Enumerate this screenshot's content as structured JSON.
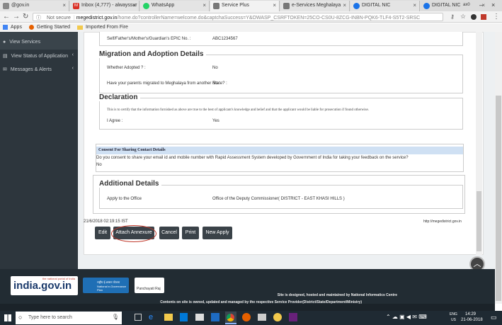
{
  "browser": {
    "tabs": [
      {
        "label": "@gov.in",
        "color": "#888888"
      },
      {
        "label": "Inbox (4,777) - alwayssur",
        "color": "#d93025"
      },
      {
        "label": "WhatsApp",
        "color": "#25d366"
      },
      {
        "label": "Service Plus",
        "color": "#777777"
      },
      {
        "label": "e-Services Meghalaya",
        "color": "#777777"
      },
      {
        "label": "DIGITAL NIC",
        "color": "#1a73e8"
      },
      {
        "label": "DIGITAL NIC",
        "color": "#1a73e8"
      }
    ],
    "active_tab": 3,
    "window_user": "ax0",
    "url_security": "Not secure",
    "url_host": "megedistrict.gov.in",
    "url_path": "/home.do?controllerName=welcome.do&captchaSuccess=Y&OWASP_CSRFTOKEN=25CO-CS0U-8ZCG-INBN-PQK6-TLF4-S5T2-SRSC",
    "bookmarks": [
      "Apps",
      "Getting Started",
      "Imported From Fire"
    ]
  },
  "sidebar": {
    "items": [
      {
        "label": "View Services",
        "icon": "circle-icon",
        "has_arrow": false
      },
      {
        "label": "View Status of Application",
        "icon": "list-icon",
        "has_arrow": true
      },
      {
        "label": "Messages & Alerts",
        "icon": "envelope-icon",
        "has_arrow": true
      }
    ]
  },
  "form": {
    "epic_label": "Self/Father's/Mother's/Guardian's EPIC No. :",
    "epic_value": "ABC1234567",
    "migration_heading": "Migration and Adoption Details",
    "adopted_label": "Whether Adopted ? :",
    "adopted_value": "No",
    "migrated_label": "Have your parents migrated to Meghalaya from another State? :",
    "migrated_value": "No",
    "declaration_heading": "Declaration",
    "declaration_text": "This is to certify that the information furnished as above are true to the best of applicant's knowledge and belief and that the applicant would be liable for prosecution if found otherwise.",
    "agree_label": "I Agree :",
    "agree_value": "Yes",
    "consent_heading": "Consent For Sharing Contact Details",
    "consent_question": "Do you consent to share your email id and mobile number with Rapid Assessment System developed by Government of India for taking your feedback on the service?",
    "consent_value": "No",
    "additional_heading": "Additional Details",
    "apply_office_label": "Apply to the Office",
    "apply_office_value": "Office of the Deputy Commissioner( DISTRICT - EAST KHASI HILLS )",
    "timestamp": "21/6/2018 02:19:15 IST",
    "site_url": "http://megedistrict.gov.in"
  },
  "buttons": {
    "edit": "Edit",
    "attach": "Attach Annexure",
    "cancel": "Cancel",
    "print": "Print",
    "new_apply": "New Apply"
  },
  "footer": {
    "logo1_caption": "the national portal of India",
    "logo1_text": "india.gov.in",
    "logo2_text": "राष्ट्रीय ई-शासन योजना National e-Governance Plan",
    "logo3_text": "Panchayati Raj",
    "line1": "Site is designed, hosted and maintained by National Informatics Centre",
    "line2": "Contents on site is owned, updated and managed by the respective Service Provider(District/State/Department/Ministry)"
  },
  "taskbar": {
    "search_placeholder": "Type here to search",
    "lang": "ENG",
    "region": "US",
    "time": "14:29",
    "date": "21-06-2018"
  }
}
